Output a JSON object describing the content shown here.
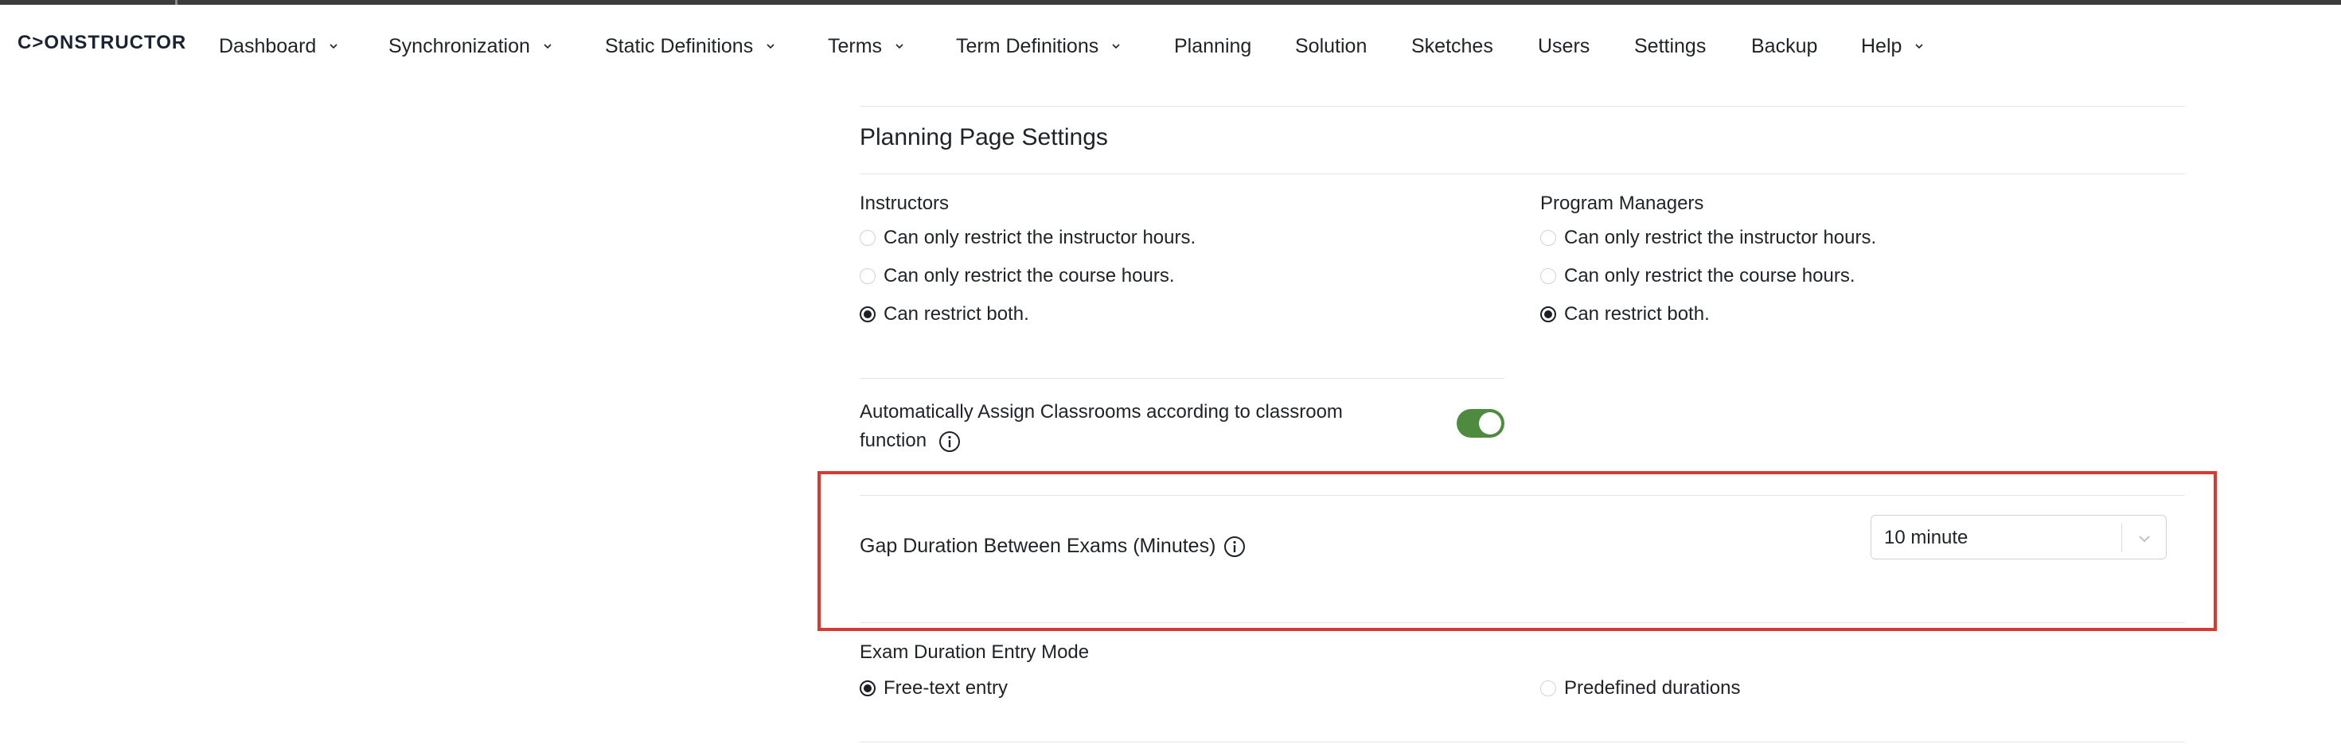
{
  "brand": {
    "logo_text": "C>ONSTRUCTOR"
  },
  "nav": {
    "items": [
      {
        "label": "Dashboard",
        "has_dropdown": true
      },
      {
        "label": "Synchronization",
        "has_dropdown": true
      },
      {
        "label": "Static Definitions",
        "has_dropdown": true
      },
      {
        "label": "Terms",
        "has_dropdown": true
      },
      {
        "label": "Term Definitions",
        "has_dropdown": true
      },
      {
        "label": "Planning",
        "has_dropdown": false
      },
      {
        "label": "Solution",
        "has_dropdown": false
      },
      {
        "label": "Sketches",
        "has_dropdown": false
      },
      {
        "label": "Users",
        "has_dropdown": false
      },
      {
        "label": "Settings",
        "has_dropdown": false
      },
      {
        "label": "Backup",
        "has_dropdown": false
      },
      {
        "label": "Help",
        "has_dropdown": true
      }
    ]
  },
  "page": {
    "title": "Planning Page Settings",
    "instructors": {
      "label": "Instructors",
      "options": [
        {
          "label": "Can only restrict the instructor hours.",
          "checked": false
        },
        {
          "label": "Can only restrict the course hours.",
          "checked": false
        },
        {
          "label": "Can restrict both.",
          "checked": true
        }
      ]
    },
    "program_managers": {
      "label": "Program Managers",
      "options": [
        {
          "label": "Can only restrict the instructor hours.",
          "checked": false
        },
        {
          "label": "Can only restrict the course hours.",
          "checked": false
        },
        {
          "label": "Can restrict both.",
          "checked": true
        }
      ]
    },
    "auto_assign": {
      "label_line1": "Automatically Assign Classrooms according to classroom",
      "label_line2": "function",
      "enabled": true
    },
    "gap_duration": {
      "label": "Gap Duration Between Exams (Minutes)",
      "selected_value": "10 minute"
    },
    "exam_entry_mode": {
      "label": "Exam Duration Entry Mode",
      "options": [
        {
          "label": "Free-text entry",
          "checked": true
        },
        {
          "label": "Predefined durations",
          "checked": false
        }
      ]
    }
  },
  "colors": {
    "toggle_on": "#4e8b3e",
    "highlight": "#d63a32"
  }
}
